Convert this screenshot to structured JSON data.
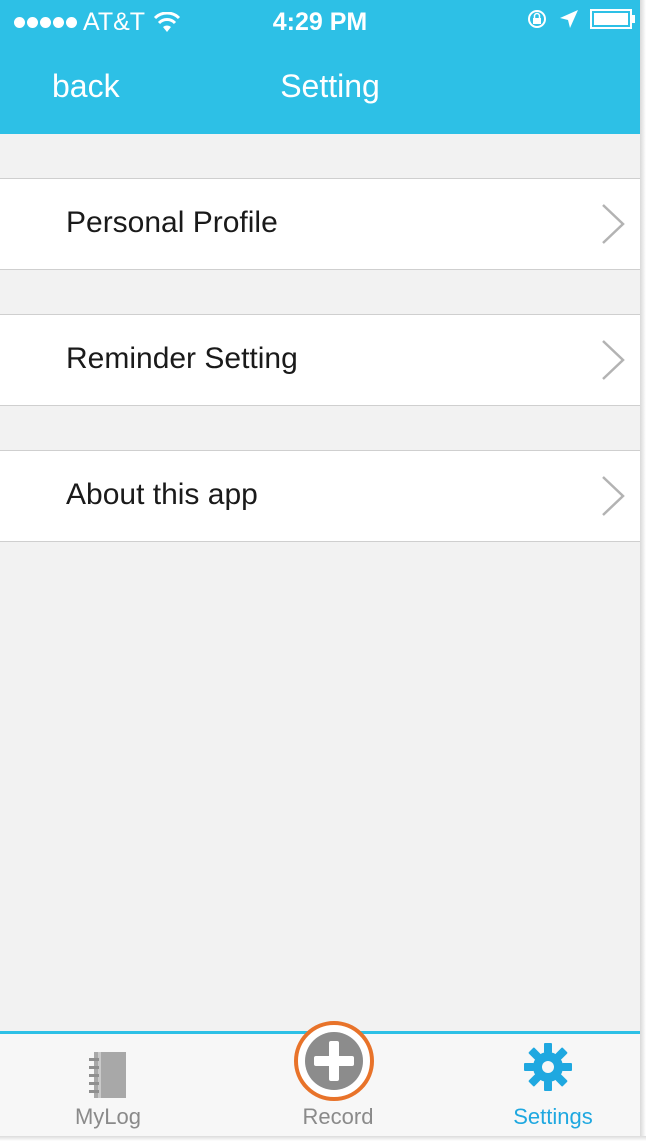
{
  "status_bar": {
    "signal_dots": 5,
    "carrier": "AT&T",
    "time": "4:29 PM",
    "icons": [
      "wifi-icon",
      "orientation-lock-icon",
      "location-icon",
      "battery-icon"
    ]
  },
  "nav": {
    "back_label": "back",
    "title": "Setting"
  },
  "settings_list": {
    "items": [
      {
        "label": "Personal Profile",
        "icon": "chevron-right-icon"
      },
      {
        "label": "Reminder Setting",
        "icon": "chevron-right-icon"
      },
      {
        "label": "About this app",
        "icon": "chevron-right-icon"
      }
    ]
  },
  "tab_bar": {
    "tabs": [
      {
        "label": "MyLog",
        "icon": "notebook-icon",
        "active": false
      },
      {
        "label": "Record",
        "icon": "plus-icon",
        "active": false
      },
      {
        "label": "Settings",
        "icon": "gear-icon",
        "active": true
      }
    ]
  },
  "colors": {
    "header_bg": "#2dc0e6",
    "tab_active": "#1fa8e0",
    "tab_inactive": "#8a8a8a",
    "record_ring": "#e8732a",
    "list_bg": "#f2f2f2"
  }
}
